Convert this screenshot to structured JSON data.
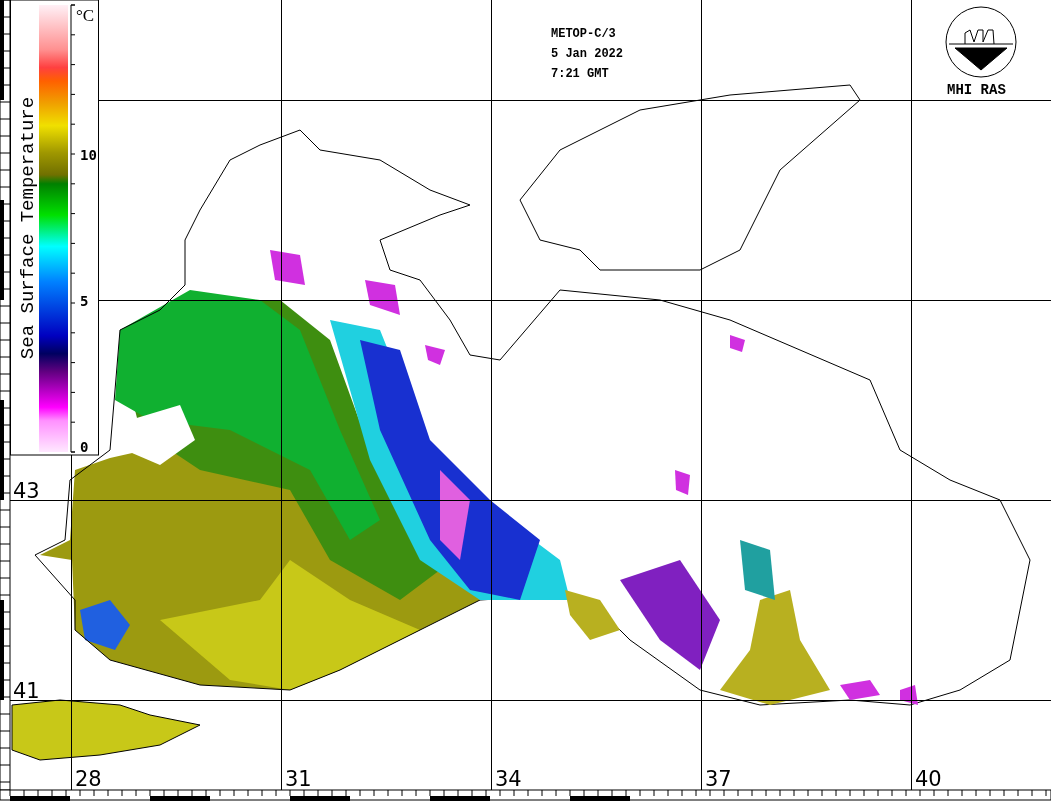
{
  "header": {
    "satellite": "METOP-C/3",
    "date": "5 Jan 2022",
    "time": "7:21 GMT"
  },
  "logo": {
    "caption": "MHI RAS"
  },
  "color_scale": {
    "title": "Sea Surface Temperature",
    "unit": "°C",
    "ticks": [
      "10",
      "5",
      "0"
    ]
  },
  "latitude_labels": [
    "43",
    "41"
  ],
  "longitude_labels": [
    "28",
    "31",
    "34",
    "37",
    "40"
  ]
}
